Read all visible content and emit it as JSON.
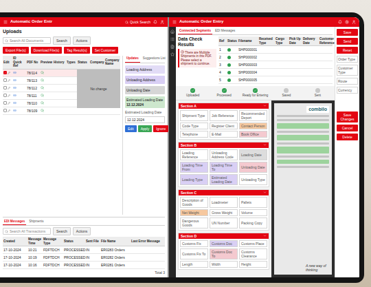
{
  "left_window": {
    "title": "Automatic Order Entr",
    "quick_search": "Quick Search",
    "page_title": "Uploads",
    "search": {
      "placeholder": "Search All Documents",
      "buttons": [
        "Search",
        "Actions"
      ]
    },
    "toolbar_buttons": [
      "Export File(s)",
      "Download File(s)",
      "Tag Result(s)",
      "Set Customer"
    ],
    "uploads_table": {
      "columns": [
        "Edit",
        "ID Quick Ref",
        "PDF No",
        "Preview",
        "History",
        "Types",
        "Status",
        "Company",
        "Company Name"
      ],
      "rows": [
        {
          "pdf_no": "78/114",
          "checked": true,
          "selected": true
        },
        {
          "pdf_no": "78/113",
          "checked": false,
          "selected": false
        },
        {
          "pdf_no": "78/112",
          "checked": false,
          "selected": false
        },
        {
          "pdf_no": "78/111",
          "checked": false,
          "selected": false
        },
        {
          "pdf_no": "78/110",
          "checked": false,
          "selected": false
        },
        {
          "pdf_no": "78/109",
          "checked": false,
          "selected": false
        }
      ]
    },
    "overlay_note": "No change",
    "side_panel": {
      "tabs": [
        {
          "label": "Updates",
          "selected": true
        },
        {
          "label": "Suggestions List",
          "selected": false
        }
      ],
      "items": [
        {
          "label": "Loading Address",
          "value": "",
          "color": "#e2dcf6"
        },
        {
          "label": "Unloading Address",
          "value": "",
          "color": "#d9cff4"
        },
        {
          "label": "Unloading Date",
          "value": "",
          "color": "#d6d6d6"
        },
        {
          "label": "Estimated Loading Date",
          "value": "12.12.2024",
          "color": "#cde7cd"
        }
      ],
      "field_label": "Estimated Loading Date",
      "field_value": "12.12.2024",
      "buttons": [
        {
          "label": "Edit",
          "color": "#2f6fd6"
        },
        {
          "label": "Apply",
          "color": "#3aa655"
        },
        {
          "label": "Ignore",
          "color": "#e30613"
        }
      ]
    },
    "bottom_tabs": [
      {
        "label": "EDI Messages",
        "selected": true
      },
      {
        "label": "Shipments",
        "selected": false
      }
    ],
    "edi_search": {
      "placeholder": "Search All Transactions",
      "buttons": [
        "Search",
        "Actions"
      ]
    },
    "edi_table": {
      "columns": [
        "Created",
        "Message Time",
        "Message Type",
        "Status",
        "Sent File",
        "File Name",
        "Last Error Message"
      ],
      "rows": [
        {
          "cells": [
            "17-10-2024",
            "10:21",
            "FDFTDCH",
            "PROCESSED",
            "IN",
            "ER0283 Orders",
            ""
          ]
        },
        {
          "cells": [
            "17-10-2024",
            "10:19",
            "FDFTDCH",
            "PROCESSED",
            "IN",
            "ER0282 Orders",
            ""
          ]
        },
        {
          "cells": [
            "17-10-2024",
            "10:16",
            "FDFTDCH",
            "PROCESSED",
            "IN",
            "ER0281 Orders",
            ""
          ]
        }
      ]
    },
    "total": "Total 3"
  },
  "right_window": {
    "title": "Automatic Order Entry",
    "tabs": [
      {
        "label": "Connected Segments",
        "selected": true
      },
      {
        "label": "EDI Messages",
        "selected": false
      }
    ],
    "panel_title": "Data Check Results",
    "alert": "There are Multiple Shipments in this PDF. Please select a shipment to continue.",
    "check_table": {
      "columns": [
        "Ref",
        "Status",
        "Filename",
        "Received Type",
        "Cargo Type",
        "Pick Up Date",
        "Delivery Date",
        "Customer Reference"
      ],
      "rows": [
        {
          "ref": "1",
          "filename": "SHP000001",
          "color": "#2e9e4f"
        },
        {
          "ref": "2",
          "filename": "SHP000002",
          "color": "#2e9e4f"
        },
        {
          "ref": "3",
          "filename": "SHP000003",
          "color": "#2e9e4f"
        },
        {
          "ref": "4",
          "filename": "SHP000004",
          "color": "#2e9e4f"
        },
        {
          "ref": "5",
          "filename": "SHP000005",
          "color": "#2e9e4f"
        }
      ]
    },
    "steps": [
      {
        "label": "Uploaded",
        "done": true
      },
      {
        "label": "Processed",
        "done": true
      },
      {
        "label": "Ready for Entering",
        "done": true
      },
      {
        "label": "Saved",
        "done": false
      },
      {
        "label": "Sent",
        "done": false
      }
    ],
    "sections": [
      {
        "title": "Section A",
        "fields": [
          {
            "label": "Shipment Type",
            "color": "#ffffff"
          },
          {
            "label": "Job Reference",
            "color": "#ffffff"
          },
          {
            "label": "Recommended Deport",
            "color": "#ffffff"
          },
          {
            "label": "Code Type",
            "color": "#ffffff"
          },
          {
            "label": "Register Client",
            "color": "#ffffff"
          },
          {
            "label": "Contact Person",
            "color": "#f6c89f"
          },
          {
            "label": "Telephone",
            "color": "#ffffff"
          },
          {
            "label": "E-Mail",
            "color": "#ffffff"
          },
          {
            "label": "Book Office",
            "color": "#f4c9cf"
          }
        ]
      },
      {
        "title": "Section B",
        "fields": [
          {
            "label": "Loading Reference",
            "color": "#ffffff"
          },
          {
            "label": "Unloading Address Code",
            "color": "#ffffff"
          },
          {
            "label": "Loading Date",
            "color": "#dddddd"
          },
          {
            "label": "Loading Time From",
            "color": "#d9cff4"
          },
          {
            "label": "Loading Time To",
            "color": "#d9cff4"
          },
          {
            "label": "Unloading Date",
            "color": "#f4c9cf"
          },
          {
            "label": "Loading Type",
            "color": "#d9cff4"
          },
          {
            "label": "Estimated Loading Date",
            "color": "#d9cff4"
          },
          {
            "label": "Unloading Type",
            "color": "#ffffff"
          }
        ]
      },
      {
        "title": "Section C",
        "fields": [
          {
            "label": "Description of Goods",
            "color": "#ffffff"
          },
          {
            "label": "Loadmeter",
            "color": "#ffffff"
          },
          {
            "label": "Pallets",
            "color": "#ffffff"
          },
          {
            "label": "Net Weight",
            "color": "#f6c89f"
          },
          {
            "label": "Gross Weight",
            "color": "#ffffff"
          },
          {
            "label": "Volume",
            "color": "#ffffff"
          },
          {
            "label": "Dangerous Goods",
            "color": "#ffffff"
          },
          {
            "label": "UN Number",
            "color": "#ffffff"
          },
          {
            "label": "Packing Copy",
            "color": "#ffffff"
          }
        ]
      },
      {
        "title": "Section D",
        "fields": [
          {
            "label": "Customs Fix",
            "color": "#ffffff"
          },
          {
            "label": "Customs Doc",
            "color": "#d9cff4"
          },
          {
            "label": "Customs Place",
            "color": "#ffffff"
          },
          {
            "label": "Customs Fix To",
            "color": "#ffffff"
          },
          {
            "label": "Customs Doc To",
            "color": "#f4c9cf"
          },
          {
            "label": "Customs Clearance",
            "color": "#ffffff"
          },
          {
            "label": "Length",
            "color": "#ffffff"
          },
          {
            "label": "Width",
            "color": "#ffffff"
          },
          {
            "label": "Height",
            "color": "#ffffff"
          }
        ]
      }
    ],
    "document": {
      "logo": "combilo",
      "tagline": "A new way of thinking"
    },
    "side_fields": [
      "Order Type",
      "Customer Type",
      "Route",
      "Currency"
    ],
    "side_buttons_top": [
      "Save",
      "Send",
      "Reset"
    ],
    "side_buttons_bottom": [
      "Save Changes",
      "Cancel",
      "Delete"
    ]
  }
}
